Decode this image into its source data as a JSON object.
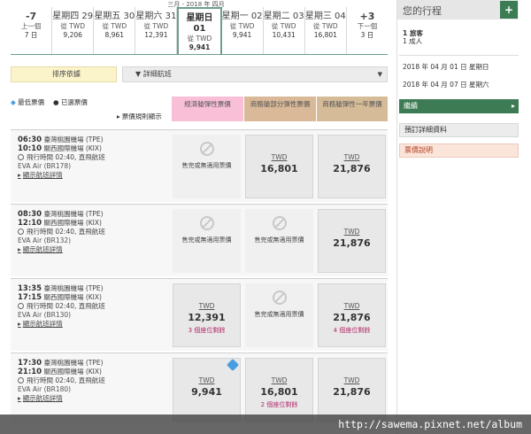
{
  "month_label": "三月 - 2018 年 四月",
  "dates": [
    {
      "top": "-7",
      "mid": "上一個",
      "bottom": "7 日",
      "type": "nav"
    },
    {
      "top": "星期四 29",
      "mid": "從 TWD",
      "bottom": "9,206"
    },
    {
      "top": "星期五 30",
      "mid": "從 TWD",
      "bottom": "8,961"
    },
    {
      "top": "星期六 31",
      "mid": "從 TWD",
      "bottom": "12,391"
    },
    {
      "top": "星期日 01",
      "mid": "從 TWD",
      "bottom": "9,941",
      "selected": true
    },
    {
      "top": "星期一 02",
      "mid": "從 TWD",
      "bottom": "9,941"
    },
    {
      "top": "星期二 03",
      "mid": "從 TWD",
      "bottom": "10,431"
    },
    {
      "top": "星期三 04",
      "mid": "從 TWD",
      "bottom": "16,801"
    },
    {
      "top": "+3",
      "mid": "下一個",
      "bottom": "3 日",
      "type": "nav"
    }
  ],
  "sort_label": "排序依據",
  "filter_label": "詳細航班",
  "legend": {
    "lowest": "最低票價",
    "selected": "已選票價",
    "rules": "票價規則顯示"
  },
  "columns": [
    "經濟艙彈性票價",
    "商務艙部分彈性票價",
    "商務艙彈性一年票價"
  ],
  "flights": [
    {
      "dep": "06:30",
      "dep_airport": "臺灣桃園機場 (TPE)",
      "arr": "10:10",
      "arr_airport": "關西國際機場 (KIX)",
      "duration": "飛行時間 02:40, 直飛航班",
      "airline": "EVA Air (BR178)",
      "details": "顯示航班詳情",
      "fares": [
        {
          "na": true,
          "text": "售完或無適用票價"
        },
        {
          "currency": "TWD",
          "amount": "16,801",
          "seats": ""
        },
        {
          "currency": "TWD",
          "amount": "21,876",
          "seats": ""
        }
      ]
    },
    {
      "dep": "08:30",
      "dep_airport": "臺灣桃園機場 (TPE)",
      "arr": "12:10",
      "arr_airport": "關西國際機場 (KIX)",
      "duration": "飛行時間 02:40, 直飛航班",
      "airline": "EVA Air (BR132)",
      "details": "顯示航班詳情",
      "fares": [
        {
          "na": true,
          "text": "售完或無適用票價"
        },
        {
          "na": true,
          "text": "售完或無適用票價"
        },
        {
          "currency": "TWD",
          "amount": "21,876",
          "seats": ""
        }
      ]
    },
    {
      "dep": "13:35",
      "dep_airport": "臺灣桃園機場 (TPE)",
      "arr": "17:15",
      "arr_airport": "關西國際機場 (KIX)",
      "duration": "飛行時間 02:40, 直飛航班",
      "airline": "EVA Air (BR130)",
      "details": "顯示航班詳情",
      "fares": [
        {
          "currency": "TWD",
          "amount": "12,391",
          "seats": "3 個座位剩餘"
        },
        {
          "na": true,
          "text": "售完或無適用票價"
        },
        {
          "currency": "TWD",
          "amount": "21,876",
          "seats": "4 個座位剩餘"
        }
      ]
    },
    {
      "dep": "17:30",
      "dep_airport": "臺灣桃園機場 (TPE)",
      "arr": "21:10",
      "arr_airport": "關西國際機場 (KIX)",
      "duration": "飛行時間 02:40, 直飛航班",
      "airline": "EVA Air (BR180)",
      "details": "顯示航班詳情",
      "fares": [
        {
          "currency": "TWD",
          "amount": "9,941",
          "seats": "",
          "lowest": true
        },
        {
          "currency": "TWD",
          "amount": "16,801",
          "seats": "2 個座位剩餘"
        },
        {
          "currency": "TWD",
          "amount": "21,876",
          "seats": ""
        }
      ]
    }
  ],
  "itinerary": {
    "title": "您的行程",
    "plus": "+",
    "pax1": "1 旅客",
    "pax2": "1 成人",
    "date1": "2018 年 04 月 01 日 星期日",
    "date2": "2018 年 04 月 07 日 星期六",
    "continue": "繼續",
    "booking": "預訂詳細資料",
    "fare_info": "票價說明"
  },
  "watermark": "http://sawema.pixnet.net/album"
}
